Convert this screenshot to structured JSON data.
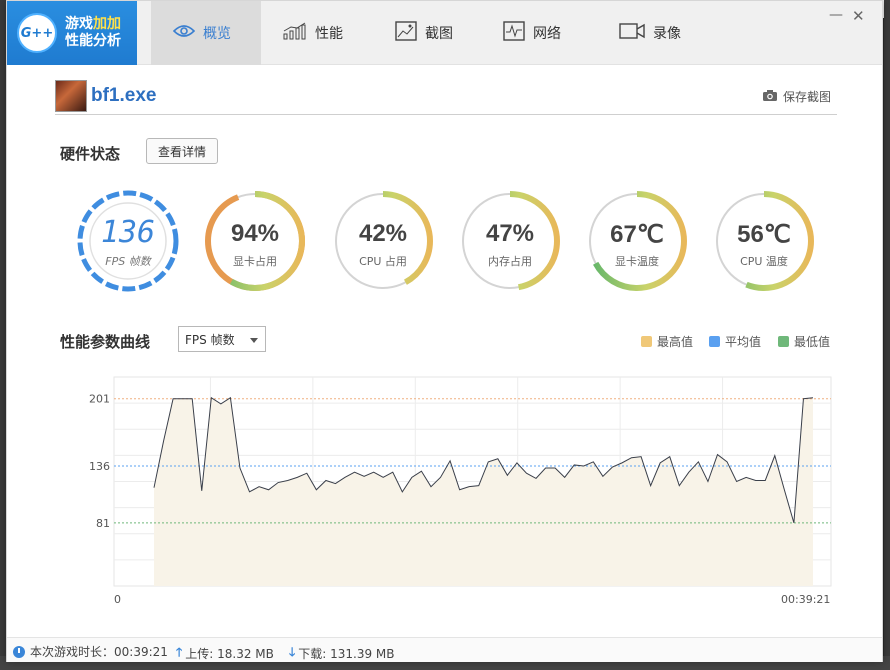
{
  "app": {
    "logo_badge": "G++",
    "logo_line1_a": "游戏",
    "logo_line1_b": "加加",
    "logo_line2": "性能分析"
  },
  "tabs": [
    {
      "label": "概览",
      "icon": "eye-icon",
      "active": true
    },
    {
      "label": "性能",
      "icon": "bar-chart-icon",
      "active": false
    },
    {
      "label": "截图",
      "icon": "image-icon",
      "active": false
    },
    {
      "label": "网络",
      "icon": "pulse-icon",
      "active": false
    },
    {
      "label": "录像",
      "icon": "video-camera-icon",
      "active": false
    }
  ],
  "window_controls": {
    "minimize": "—",
    "close": "✕"
  },
  "game": {
    "name": "bf1.exe",
    "save_screenshot_label": "保存截图"
  },
  "hardware": {
    "title": "硬件状态",
    "details_button": "查看详情",
    "gauges": [
      {
        "id": "fps",
        "value": "136",
        "label": "FPS 帧数",
        "fraction": 1.0
      },
      {
        "id": "gpu-usage",
        "value": "94%",
        "label": "显卡占用",
        "fraction": 0.94
      },
      {
        "id": "cpu-usage",
        "value": "42%",
        "label": "CPU 占用",
        "fraction": 0.42
      },
      {
        "id": "mem-usage",
        "value": "47%",
        "label": "内存占用",
        "fraction": 0.47
      },
      {
        "id": "gpu-temp",
        "value": "67℃",
        "label": "显卡温度",
        "fraction": 0.67
      },
      {
        "id": "cpu-temp",
        "value": "56℃",
        "label": "CPU 温度",
        "fraction": 0.56
      }
    ]
  },
  "chart_section": {
    "title": "性能参数曲线",
    "select_value": "FPS 帧数",
    "legend": [
      {
        "label": "最高值",
        "color": "#f0c878"
      },
      {
        "label": "平均值",
        "color": "#5aa0f0"
      },
      {
        "label": "最低值",
        "color": "#6fb87a"
      }
    ],
    "x_start_label": "0",
    "x_end_label": "00:39:21"
  },
  "chart_data": {
    "type": "area",
    "title": "",
    "xlabel": "",
    "ylabel": "",
    "ylim": [
      20,
      222
    ],
    "y_ticks": [
      201,
      136,
      81
    ],
    "reference_lines": {
      "max": 201,
      "avg": 136,
      "min": 81
    },
    "series": [
      {
        "name": "FPS 帧数",
        "values": [
          115,
          160,
          201,
          201,
          201,
          112,
          202,
          196,
          202,
          134,
          111,
          116,
          113,
          120,
          122,
          125,
          129,
          113,
          122,
          119,
          125,
          130,
          126,
          130,
          125,
          130,
          111,
          125,
          131,
          116,
          125,
          141,
          113,
          116,
          117,
          140,
          143,
          127,
          139,
          129,
          124,
          134,
          134,
          125,
          137,
          136,
          140,
          126,
          135,
          139,
          144,
          145,
          117,
          139,
          145,
          117,
          130,
          140,
          121,
          147,
          140,
          121,
          125,
          122,
          122,
          146,
          113,
          81,
          201,
          202
        ]
      }
    ]
  },
  "footer": {
    "session_label": "本次游戏时长：00:39:21",
    "upload_label": "上传: 18.32 MB",
    "download_label": "下载: 131.39 MB"
  }
}
